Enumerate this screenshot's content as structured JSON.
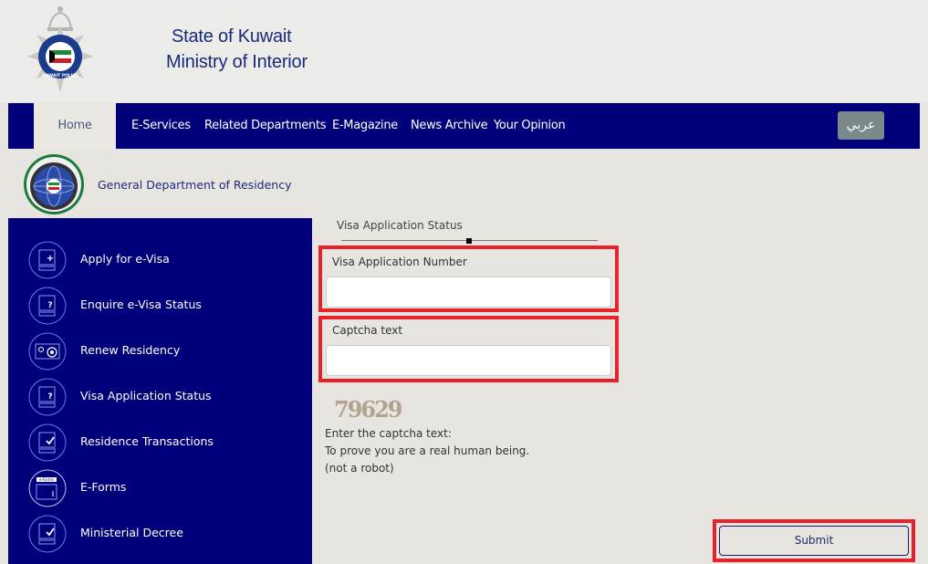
{
  "header": {
    "title_line1": "State of Kuwait",
    "title_line2": "Ministry of Interior",
    "logo": "kuwait-police-emblem"
  },
  "nav": {
    "items": [
      {
        "label": "Home",
        "active": true
      },
      {
        "label": "E-Services"
      },
      {
        "label": "Related Departments"
      },
      {
        "label": "E-Magazine"
      },
      {
        "label": "News Archive"
      },
      {
        "label": "Your Opinion"
      }
    ],
    "language_button": "عربي"
  },
  "department": {
    "title": "General Department of Residency",
    "logo": "residency-department-emblem"
  },
  "sidebar": {
    "items": [
      {
        "label": "Apply for e-Visa",
        "icon": "document-plus-icon"
      },
      {
        "label": "Enquire e-Visa Status",
        "icon": "document-question-icon"
      },
      {
        "label": "Renew Residency",
        "icon": "residency-card-icon"
      },
      {
        "label": "Visa Application Status",
        "icon": "document-question-icon"
      },
      {
        "label": "Residence Transactions",
        "icon": "document-check-icon"
      },
      {
        "label": "E-Forms",
        "icon": "eforms-icon"
      },
      {
        "label": "Ministerial Decree",
        "icon": "document-check-icon"
      }
    ]
  },
  "form": {
    "title": "Visa Application Status",
    "fields": {
      "application_number": {
        "label": "Visa Application Number",
        "value": "",
        "placeholder": ""
      },
      "captcha": {
        "label": "Captcha text",
        "value": "",
        "placeholder": ""
      }
    },
    "captcha_image_text": "79629",
    "captcha_notes": [
      "Enter the captcha text:",
      "To prove you are a real human being.",
      "(not a robot)"
    ],
    "submit_label": "Submit"
  },
  "colors": {
    "brand_navy": "#00007a",
    "highlight_red": "#e8222a",
    "background": "#e8e5e0"
  }
}
